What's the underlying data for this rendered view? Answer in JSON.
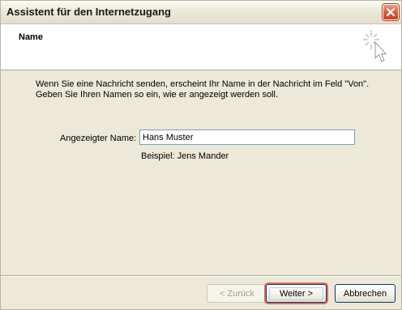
{
  "window": {
    "title": "Assistent für den Internetzugang"
  },
  "header": {
    "title": "Name",
    "icon": "wizard-sparkle-cursor-icon"
  },
  "intro": {
    "line1": "Wenn Sie eine Nachricht senden, erscheint Ihr Name in der Nachricht im Feld \"Von\".",
    "line2": "Geben Sie Ihren Namen so ein, wie er angezeigt werden soll."
  },
  "form": {
    "name_label": "Angezeigter Name:",
    "name_value": "Hans Muster",
    "example": "Beispiel: Jens Mander"
  },
  "buttons": {
    "back": "< Zurück",
    "next": "Weiter >",
    "cancel": "Abbrechen"
  },
  "colors": {
    "close_button": "#e2613f",
    "highlight": "#e36b5f",
    "dialog_bg": "#ece9d8"
  }
}
